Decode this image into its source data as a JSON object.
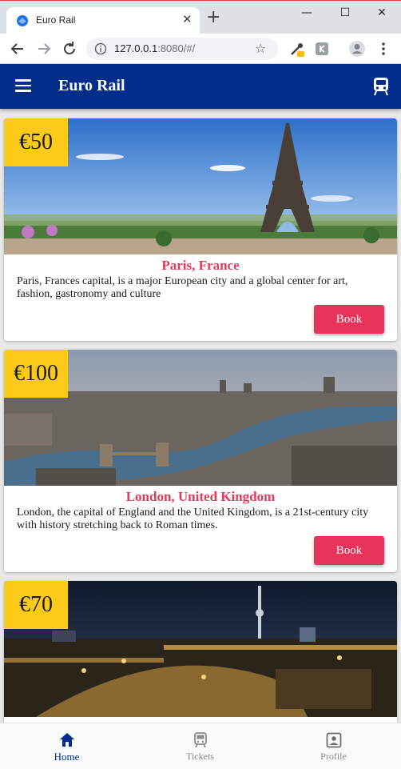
{
  "browser": {
    "tab_title": "Euro Rail",
    "url_host": "127.0.0.1",
    "url_rest": ":8080/#/"
  },
  "app": {
    "title": "Euro Rail",
    "brand_color": "#002c8a",
    "accent_color": "#e8345a",
    "price_badge_color": "#fccb19"
  },
  "destinations": [
    {
      "price": "€50",
      "city": "Paris, France",
      "description": "Paris, Frances capital, is a major European city and a global center for art, fashion, gastronomy and culture",
      "button": "Book"
    },
    {
      "price": "€100",
      "city": "London, United Kingdom",
      "description": "London, the capital of England and the United Kingdom, is a 21st-century city with history stretching back to Roman times.",
      "button": "Book"
    },
    {
      "price": "€70"
    }
  ],
  "bottom_nav": [
    {
      "label": "Home",
      "icon": "home-icon",
      "active": true
    },
    {
      "label": "Tickets",
      "icon": "train-icon",
      "active": false
    },
    {
      "label": "Profile",
      "icon": "profile-icon",
      "active": false
    }
  ]
}
